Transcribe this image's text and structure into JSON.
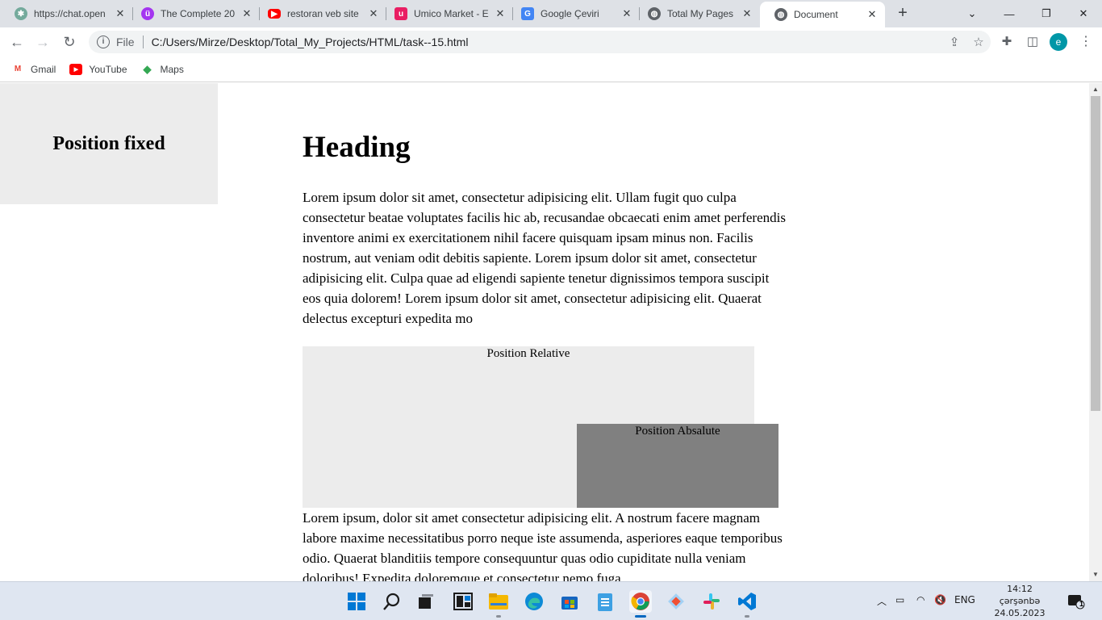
{
  "tabs": [
    {
      "label": "https://chat.open",
      "icon": "chatgpt-icon",
      "color": "#74aa9c"
    },
    {
      "label": "The Complete 20",
      "icon": "udemy-icon",
      "color": "#a435f0"
    },
    {
      "label": "restoran veb site",
      "icon": "youtube-icon",
      "color": "#ff0000"
    },
    {
      "label": "Umico Market - E",
      "icon": "umico-icon",
      "color": "#e91e63"
    },
    {
      "label": "Google Çeviri",
      "icon": "google-translate-icon",
      "color": "#4285f4"
    },
    {
      "label": "Total My Pages",
      "icon": "globe-icon",
      "color": "#5f6368"
    },
    {
      "label": "Document",
      "icon": "globe-icon",
      "color": "#5f6368"
    }
  ],
  "toolbar": {
    "scheme": "File",
    "url": "C:/Users/Mirze/Desktop/Total_My_Projects/HTML/task--15.html",
    "profile_initial": "e"
  },
  "bookmarks": [
    {
      "label": "Gmail",
      "icon": "gmail-icon"
    },
    {
      "label": "YouTube",
      "icon": "youtube-icon"
    },
    {
      "label": "Maps",
      "icon": "maps-icon"
    }
  ],
  "page": {
    "fixed_title": "Position fixed",
    "heading": "Heading",
    "paragraph1": "Lorem ipsum dolor sit amet, consectetur adipisicing elit. Ullam fugit quo culpa consectetur beatae voluptates facilis hic ab, recusandae obcaecati enim amet perferendis inventore animi ex exercitationem nihil facere quisquam ipsam minus non. Facilis nostrum, aut veniam odit debitis sapiente. Lorem ipsum dolor sit amet, consectetur adipisicing elit. Culpa quae ad eligendi sapiente tenetur dignissimos tempora suscipit eos quia dolorem! Lorem ipsum dolor sit amet, consectetur adipisicing elit. Quaerat delectus excepturi expedita mo",
    "relative_label": "Position Relative",
    "absolute_label": "Position Absalute",
    "paragraph2": "Lorem ipsum, dolor sit amet consectetur adipisicing elit. A nostrum facere magnam labore maxime necessitatibus porro neque iste assumenda, asperiores eaque temporibus odio. Quaerat blanditiis tempore consequuntur quas odio cupiditate nulla veniam doloribus! Expedita doloremque et consectetur nemo fuga"
  },
  "taskbar": {
    "apps": [
      "windows-start-icon",
      "search-icon",
      "task-view-icon",
      "widgets-icon",
      "file-explorer-icon",
      "edge-icon",
      "store-icon",
      "notepad-icon",
      "chrome-icon",
      "git-icon",
      "slack-icon",
      "vscode-icon"
    ],
    "language": "ENG",
    "time": "14:12",
    "day": "çərşənbə",
    "date": "24.05.2023",
    "notification_count": "1"
  }
}
